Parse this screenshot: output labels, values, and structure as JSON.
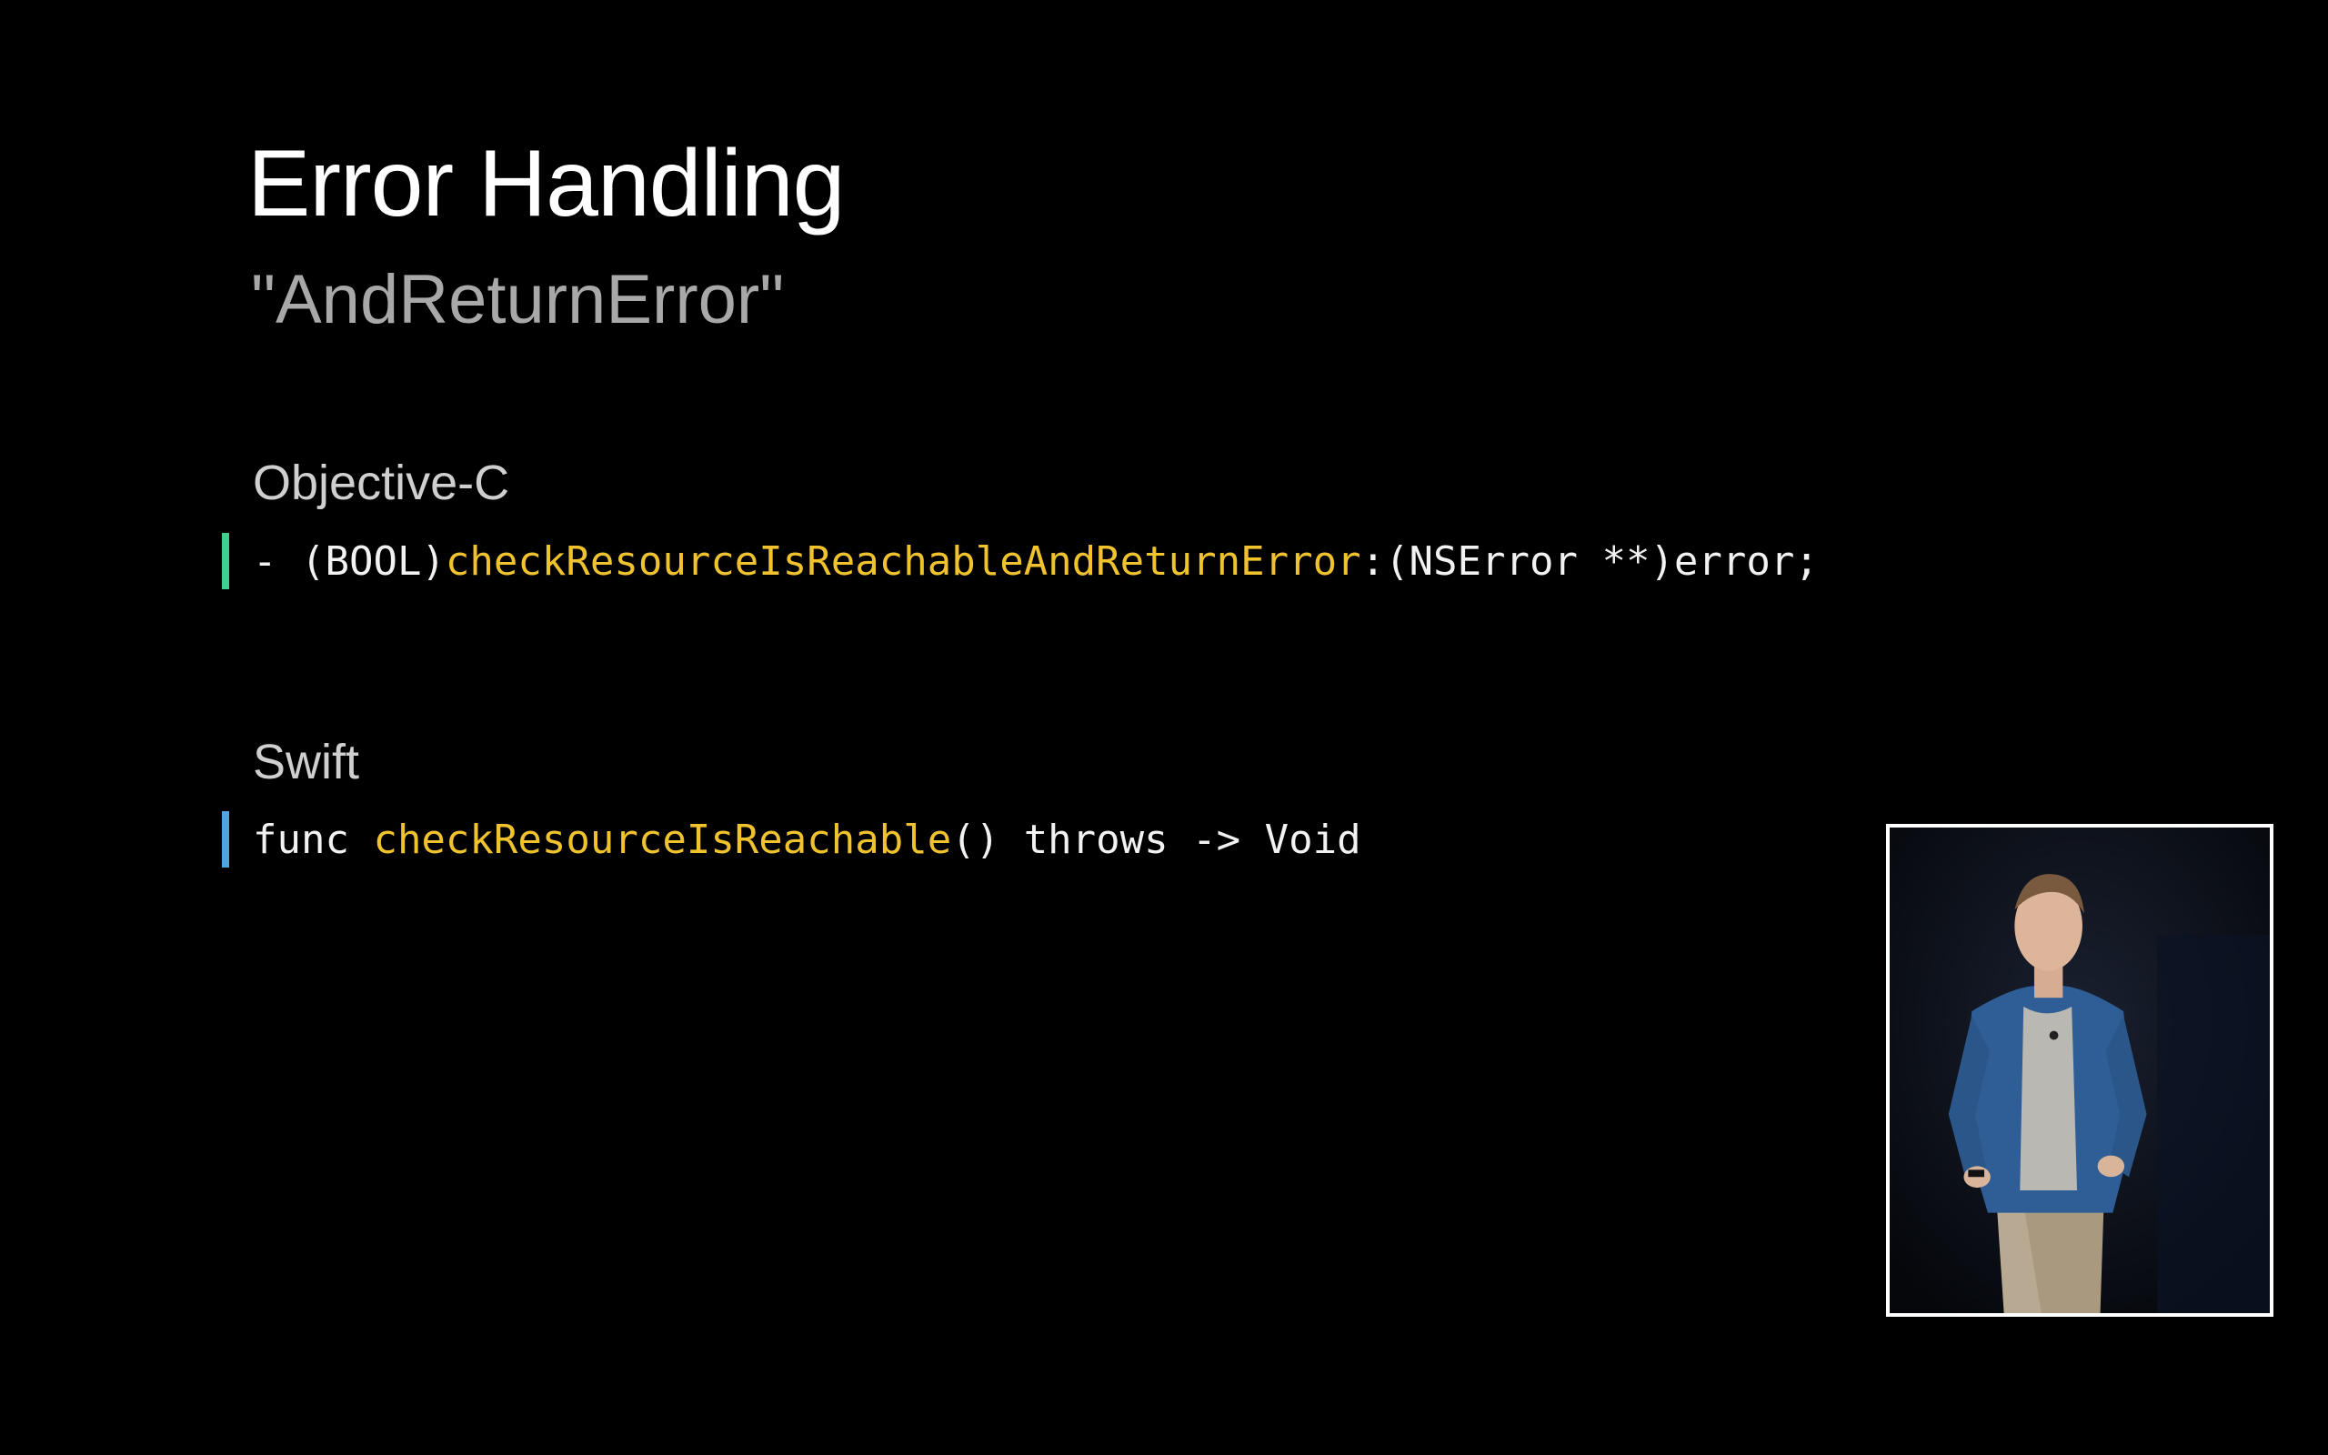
{
  "slide": {
    "title": "Error Handling",
    "subtitle": "\"AndReturnError\""
  },
  "objc": {
    "label": "Objective-C",
    "code_prefix": "- (BOOL)",
    "code_method": "checkResourceIsReachableAndReturnError",
    "code_suffix": ":(NSError **)error;"
  },
  "swift": {
    "label": "Swift",
    "code_prefix": "func ",
    "code_method": "checkResourceIsReachable",
    "code_suffix": "() throws -> Void"
  },
  "colors": {
    "background": "#000000",
    "method_highlight": "#f0c22e",
    "objc_bar": "#3fcf8e",
    "swift_bar": "#4ea3e0"
  },
  "presenter_video": {
    "icon": "presenter-video-icon"
  }
}
